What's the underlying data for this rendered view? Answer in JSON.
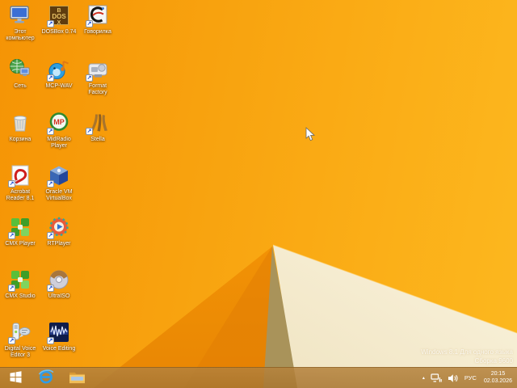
{
  "desktop": {
    "icons": [
      {
        "kind": "this-pc",
        "label": "Этот компьютер",
        "col": 0,
        "row": 0,
        "shortcut": false
      },
      {
        "kind": "dosbox",
        "label": "DOSBox 0.74",
        "col": 1,
        "row": 0,
        "shortcut": true
      },
      {
        "kind": "govorilka",
        "label": "Говорилка",
        "col": 2,
        "row": 0,
        "shortcut": true
      },
      {
        "kind": "network",
        "label": "Сеть",
        "col": 0,
        "row": 1,
        "shortcut": false
      },
      {
        "kind": "mcp-wav",
        "label": "MCP-WAV",
        "col": 1,
        "row": 1,
        "shortcut": true
      },
      {
        "kind": "format-factory",
        "label": "Format Factory",
        "col": 2,
        "row": 1,
        "shortcut": true
      },
      {
        "kind": "recycle-bin",
        "label": "Корзина",
        "col": 0,
        "row": 2,
        "shortcut": false
      },
      {
        "kind": "midradio",
        "label": "MidRadio Player",
        "col": 1,
        "row": 2,
        "shortcut": true
      },
      {
        "kind": "stella",
        "label": "Stella",
        "col": 2,
        "row": 2,
        "shortcut": true
      },
      {
        "kind": "acrobat",
        "label": "Acrobat Reader 8.1",
        "col": 0,
        "row": 3,
        "shortcut": true
      },
      {
        "kind": "virtualbox",
        "label": "Oracle VM VirtualBox",
        "col": 1,
        "row": 3,
        "shortcut": true
      },
      {
        "kind": "cmx-player",
        "label": "CMX Player",
        "col": 0,
        "row": 4,
        "shortcut": true
      },
      {
        "kind": "rtplayer",
        "label": "RTPlayer",
        "col": 1,
        "row": 4,
        "shortcut": true
      },
      {
        "kind": "cmx-studio",
        "label": "CMX Studio",
        "col": 0,
        "row": 5,
        "shortcut": true
      },
      {
        "kind": "ultraiso",
        "label": "UltraISO",
        "col": 1,
        "row": 5,
        "shortcut": true
      },
      {
        "kind": "dve",
        "label": "Digital Voice Editor 3",
        "col": 0,
        "row": 6,
        "shortcut": true
      },
      {
        "kind": "voice-editing",
        "label": "Voice Editing",
        "col": 1,
        "row": 6,
        "shortcut": true
      }
    ]
  },
  "taskbar": {
    "buttons": [
      {
        "icon": "windows-start-icon"
      },
      {
        "icon": "internet-explorer-icon"
      },
      {
        "icon": "file-explorer-icon"
      }
    ]
  },
  "tray": {
    "hidden_icons_caret": "▴",
    "language": "РУС",
    "time": "20:15",
    "date": "02.03.2026"
  },
  "watermark": {
    "line1": "Windows 8.1 Для одного языка",
    "line2": "Сборка 9600"
  },
  "colors": {
    "wallpaper_orange": "#F9A30D",
    "wallpaper_dark_wedge": "#E88604",
    "wallpaper_shadow": "#A9935A",
    "wallpaper_cream": "#F7EED2",
    "taskbar": "#B2823C"
  }
}
